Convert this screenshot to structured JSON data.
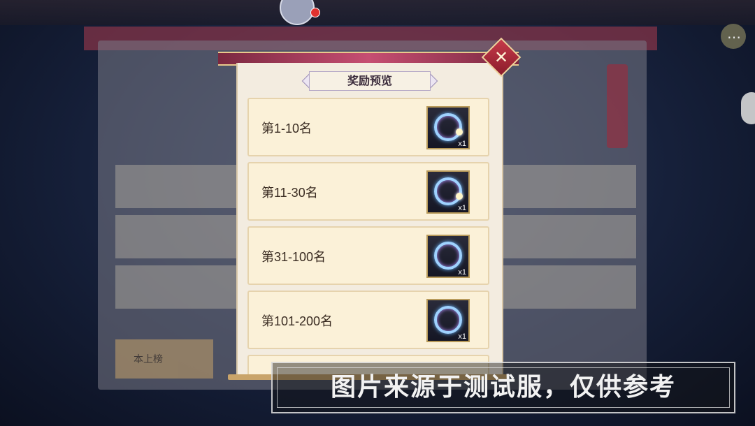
{
  "background": {
    "left_button_label": "本上榜"
  },
  "modal": {
    "title": "奖励预览",
    "close_icon": "close-x-icon",
    "rewards": [
      {
        "rank": "第1-10名",
        "item_icon": "ring-frame-icon",
        "count": "x1"
      },
      {
        "rank": "第11-30名",
        "item_icon": "ring-frame-icon",
        "count": "x1"
      },
      {
        "rank": "第31-100名",
        "item_icon": "ring-frame-icon",
        "count": "x1"
      },
      {
        "rank": "第101-200名",
        "item_icon": "ring-frame-icon",
        "count": "x1"
      }
    ]
  },
  "watermark": "图片来源于测试服，仅供参考",
  "colors": {
    "accent": "#c64e72",
    "panel": "#f3ece0",
    "row": "#fbf1d8"
  }
}
